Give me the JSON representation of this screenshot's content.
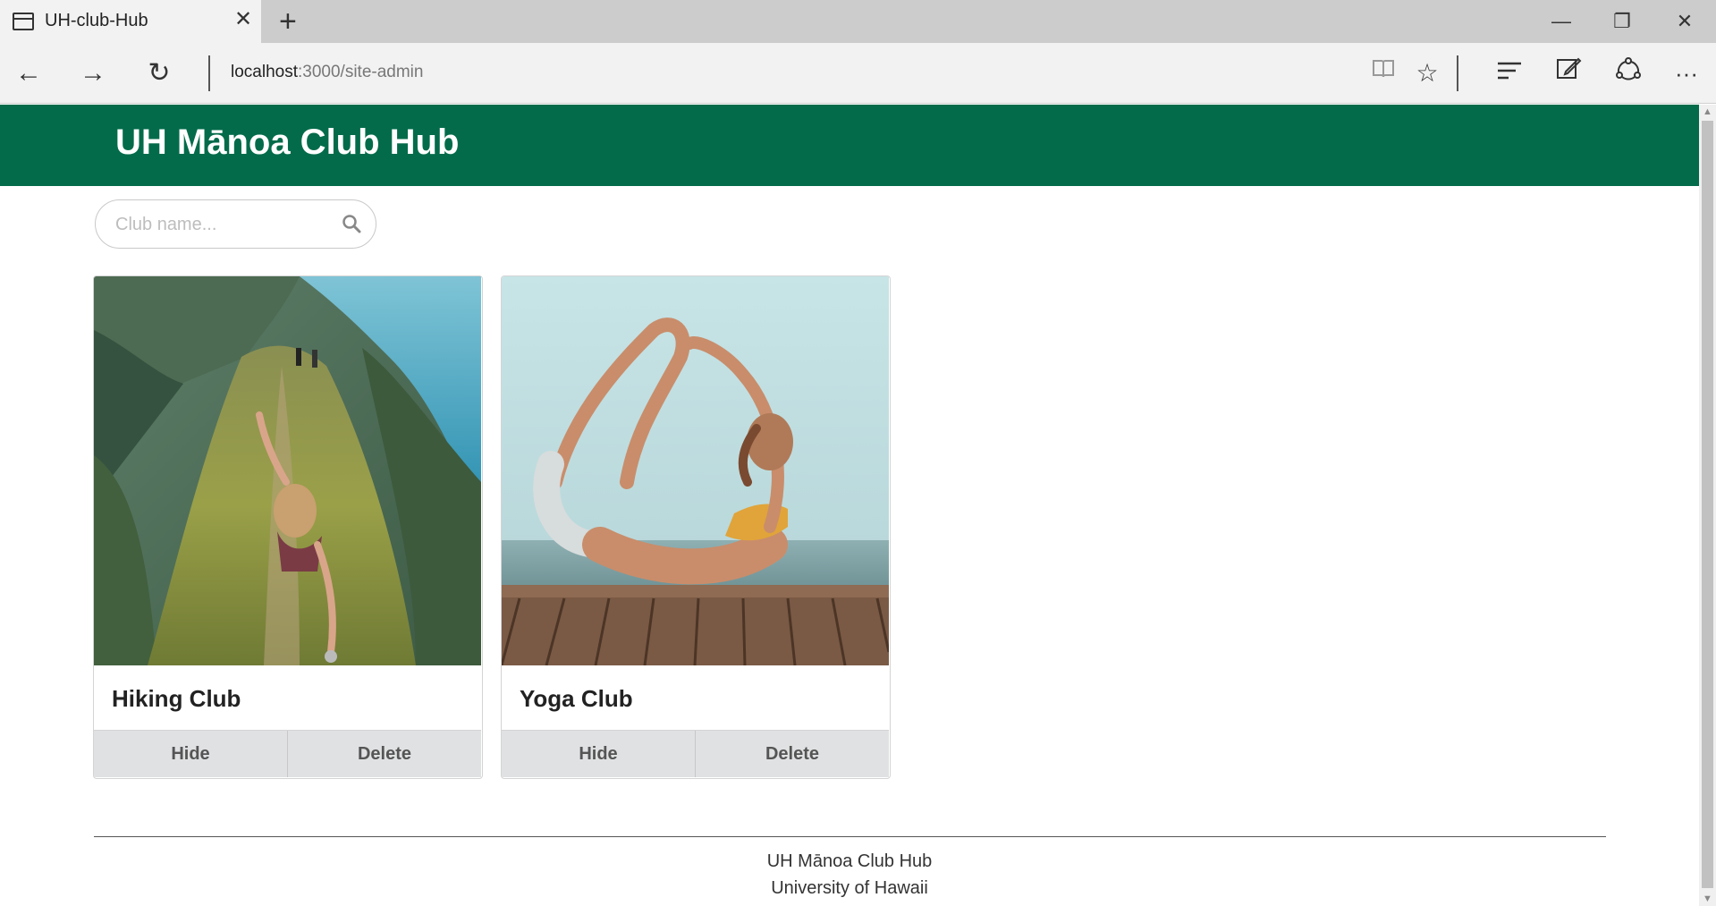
{
  "browser": {
    "tab_title": "UH-club-Hub",
    "new_tab_symbol": "+",
    "url_host": "localhost",
    "url_path": ":3000/site-admin",
    "icons": {
      "tab": "page-icon",
      "close_tab": "close-icon",
      "back": "arrow-left-icon",
      "forward": "arrow-right-icon",
      "reload": "refresh-icon",
      "reading_view": "book-icon",
      "favorite": "star-icon",
      "hub": "hub-icon",
      "web_note": "pen-note-icon",
      "share": "share-icon",
      "more": "more-icon",
      "minimize": "minimize-icon",
      "restore": "restore-icon",
      "close_window": "close-icon"
    }
  },
  "site": {
    "title": "UH Mānoa Club Hub",
    "brand_color": "#036b4a"
  },
  "search": {
    "placeholder": "Club name...",
    "value": "",
    "icon": "search-icon"
  },
  "clubs": [
    {
      "name": "Hiking Club",
      "image": "hiker on mountain ridge",
      "hide_label": "Hide",
      "delete_label": "Delete"
    },
    {
      "name": "Yoga Club",
      "image": "yoga bow pose by the sea",
      "hide_label": "Hide",
      "delete_label": "Delete"
    }
  ],
  "footer": {
    "line1": "UH Mānoa Club Hub",
    "line2": "University of Hawaii"
  }
}
